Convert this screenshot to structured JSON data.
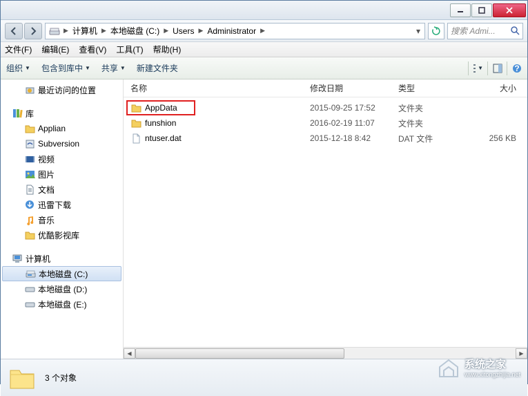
{
  "breadcrumb": {
    "segments": [
      "计算机",
      "本地磁盘 (C:)",
      "Users",
      "Administrator"
    ]
  },
  "search": {
    "placeholder": "搜索 Admi..."
  },
  "menus": {
    "file": "文件(F)",
    "edit": "编辑(E)",
    "view": "查看(V)",
    "tools": "工具(T)",
    "help": "帮助(H)"
  },
  "toolbar": {
    "organize": "组织",
    "include": "包含到库中",
    "share": "共享",
    "newfolder": "新建文件夹"
  },
  "sidebar": {
    "recent": "最近访问的位置",
    "libraries": "库",
    "lib_items": [
      "Applian",
      "Subversion",
      "视频",
      "图片",
      "文档",
      "迅雷下载",
      "音乐",
      "优酷影视库"
    ],
    "computer": "计算机",
    "drives": [
      "本地磁盘 (C:)",
      "本地磁盘 (D:)",
      "本地磁盘 (E:)"
    ]
  },
  "columns": {
    "name": "名称",
    "modified": "修改日期",
    "type": "类型",
    "size": "大小"
  },
  "files": [
    {
      "name": "AppData",
      "date": "2015-09-25 17:52",
      "type": "文件夹",
      "size": ""
    },
    {
      "name": "funshion",
      "date": "2016-02-19 11:07",
      "type": "文件夹",
      "size": ""
    },
    {
      "name": "ntuser.dat",
      "date": "2015-12-18 8:42",
      "type": "DAT 文件",
      "size": "256 KB"
    }
  ],
  "status": {
    "count": "3 个对象"
  },
  "watermark": {
    "line1": "系统之家",
    "line2": "www.xitongzhijia.net"
  }
}
